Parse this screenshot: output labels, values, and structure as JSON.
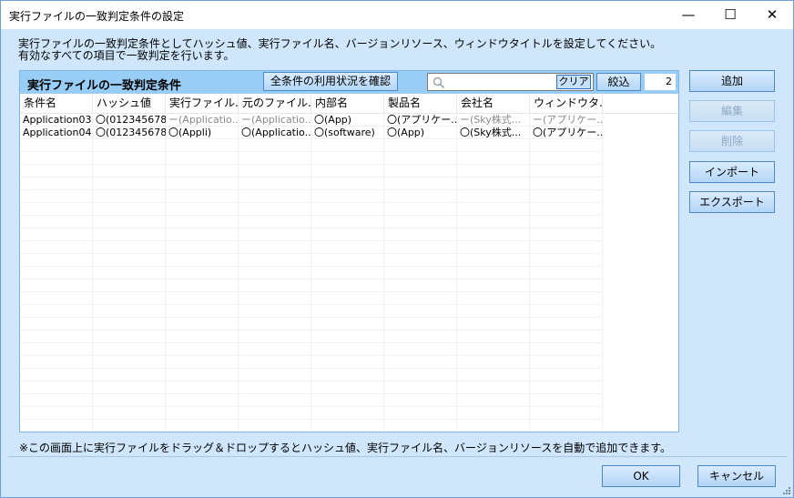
{
  "window": {
    "title": "実行ファイルの一致判定条件の設定",
    "minimize": "—",
    "maximize": "☐",
    "close": "✕"
  },
  "description": {
    "line1": "実行ファイルの一致判定条件としてハッシュ値、実行ファイル名、バージョンリソース、ウィンドウタイトルを設定してください。",
    "line2": "有効なすべての項目で一致判定を行います。"
  },
  "panel": {
    "title": "実行ファイルの一致判定条件",
    "usage_button": "全条件の利用状況を確認",
    "search": {
      "value": "",
      "placeholder": ""
    },
    "clear_button": "クリア",
    "filter_button": "絞込",
    "count": "2"
  },
  "table": {
    "columns": [
      "条件名",
      "ハッシュ値",
      "実行ファイル...",
      "元のファイル...",
      "内部名",
      "製品名",
      "会社名",
      "ウィンドウタ..."
    ],
    "rows": [
      [
        "Application03",
        "〇(012345678...",
        "ー(Applicatio...",
        "ー(Applicatio...",
        "〇(App)",
        "〇(アプリケー...",
        "ー(Sky株式...",
        "ー(アプリケー..."
      ],
      [
        "Application04",
        "〇(012345678...",
        "〇(Appli)",
        "〇(Applicatio...",
        "〇(software)",
        "〇(App)",
        "〇(Sky株式...",
        "〇(アプリケー..."
      ]
    ]
  },
  "side_buttons": {
    "add": "追加",
    "edit": "編集",
    "delete": "削除",
    "import": "インポート",
    "export": "エクスポート"
  },
  "footnote": "※この画面上に実行ファイルをドラッグ＆ドロップするとハッシュ値、実行ファイル名、バージョンリソースを自動で追加できます。",
  "dialog_buttons": {
    "ok": "OK",
    "cancel": "キャンセル"
  },
  "colors": {
    "client_bg": "#cfe6fb",
    "panel_header": "#98cdf5",
    "panel_border": "#7eb4ea",
    "disabled_text": "#8ea9c4"
  }
}
